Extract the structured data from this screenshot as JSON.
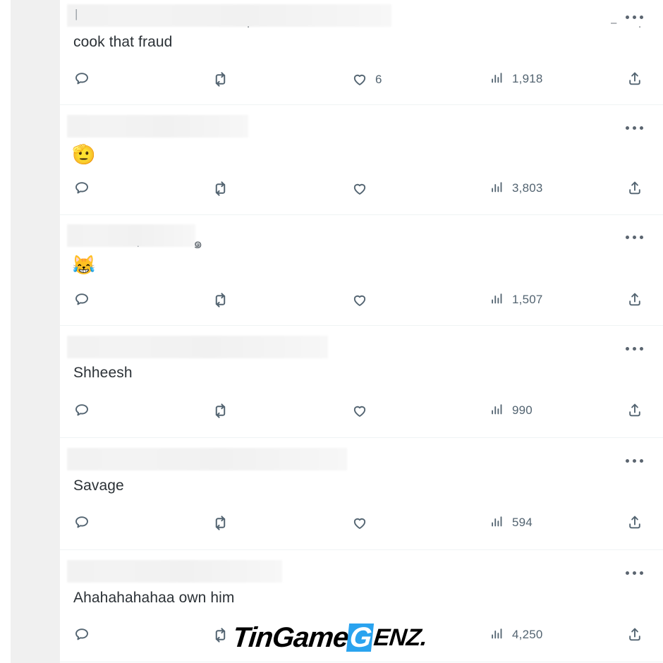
{
  "app": {
    "name": "twitter-replies-feed",
    "background": "#ffffff",
    "divider_color": "#eff3f4",
    "text_color": "#2b3136",
    "meta_color": "#536471",
    "redaction_color": "#f2f2f2"
  },
  "watermark": {
    "part1": "TinGame",
    "part2": "G",
    "part3": "ENZ.",
    "accent_color": "#2aa3ef"
  },
  "icons": {
    "reply": "reply-icon",
    "retweet": "retweet-icon",
    "like": "heart-icon",
    "views": "views-bar-chart-icon",
    "share": "share-upload-icon",
    "more": "more-horizontal-icon"
  },
  "tweets": [
    {
      "id": "tweet-1",
      "author_redacted": true,
      "redaction_width": 460,
      "ghost_text": "|",
      "text": "cook that fraud",
      "emoji": "",
      "reply_count": "",
      "retweet_count": "",
      "like_count": "6",
      "view_count": "1,918"
    },
    {
      "id": "tweet-2",
      "author_redacted": true,
      "redaction_width": 257,
      "ghost_text": "",
      "text": "",
      "emoji": "🫡",
      "reply_count": "",
      "retweet_count": "",
      "like_count": "",
      "view_count": "3,803"
    },
    {
      "id": "tweet-3",
      "author_redacted": true,
      "redaction_width": 182,
      "ghost_text": "",
      "text": "",
      "emoji": "😹",
      "reply_count": "",
      "retweet_count": "",
      "like_count": "",
      "view_count": "1,507"
    },
    {
      "id": "tweet-4",
      "author_redacted": true,
      "redaction_width": 370,
      "ghost_text": "",
      "text": "Shheesh",
      "emoji": "",
      "reply_count": "",
      "retweet_count": "",
      "like_count": "",
      "view_count": "990"
    },
    {
      "id": "tweet-5",
      "author_redacted": true,
      "redaction_width": 397,
      "ghost_text": "",
      "text": "Savage",
      "emoji": "",
      "reply_count": "",
      "retweet_count": "",
      "like_count": "",
      "view_count": "594"
    },
    {
      "id": "tweet-6",
      "author_redacted": true,
      "redaction_width": 305,
      "ghost_text": "",
      "text": "Ahahahahahaa own him",
      "emoji": "",
      "reply_count": "",
      "retweet_count": "",
      "like_count": "",
      "view_count": "4,250"
    }
  ]
}
